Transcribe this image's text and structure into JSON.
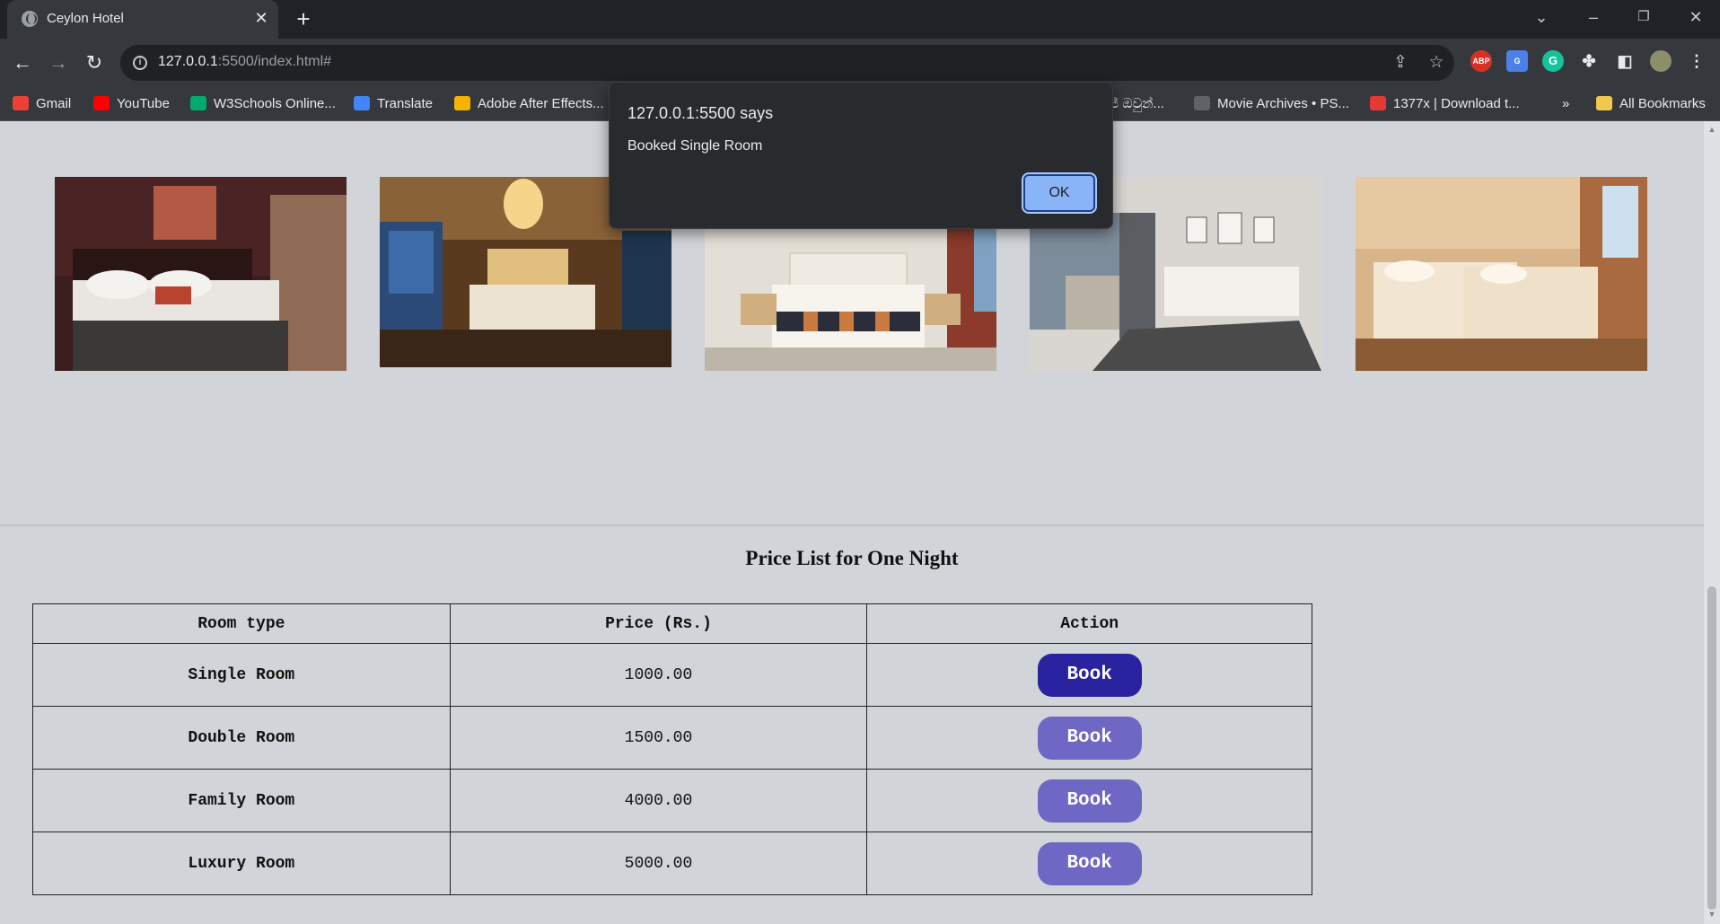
{
  "browser": {
    "tab_title": "Ceylon Hotel",
    "url_host": "127.0.0.1",
    "url_rest": ":5500/index.html#",
    "bookmarks": [
      {
        "label": "Gmail",
        "icon": "gmail-icon",
        "color": "#ea4335"
      },
      {
        "label": "YouTube",
        "icon": "youtube-icon",
        "color": "#ff0000"
      },
      {
        "label": "W3Schools Online...",
        "icon": "w3schools-icon",
        "color": "#04aa6d"
      },
      {
        "label": "Translate",
        "icon": "translate-icon",
        "color": "#4285f4"
      },
      {
        "label": "Adobe After Effects...",
        "icon": "adobe-icon",
        "color": "#f4b400"
      },
      {
        "label": "ජ් ඔවුන්...",
        "icon": "bookmark-icon",
        "color": "#5f6368"
      },
      {
        "label": "Movie Archives • PS...",
        "icon": "movie-icon",
        "color": "#5f6368"
      },
      {
        "label": "1377x | Download t...",
        "icon": "x-icon",
        "color": "#e53935"
      },
      {
        "label": "All Bookmarks",
        "icon": "folder-icon",
        "color": "#f2c94c"
      }
    ],
    "overflow_label": "»"
  },
  "alert": {
    "title": "127.0.0.1:5500 says",
    "message": "Booked Single Room",
    "ok_label": "OK"
  },
  "gallery": {
    "images": [
      "room-photo-1",
      "room-photo-2",
      "room-photo-3",
      "room-photo-4",
      "room-photo-5"
    ]
  },
  "price_list": {
    "heading": "Price List for One Night",
    "columns": [
      "Room type",
      "Price (Rs.)",
      "Action"
    ],
    "rows": [
      {
        "room": "Single Room",
        "price": "1000.00",
        "action": "Book",
        "button_color": "#2a23a0"
      },
      {
        "room": "Double Room",
        "price": "1500.00",
        "action": "Book",
        "button_color": "#6f67c4"
      },
      {
        "room": "Family Room",
        "price": "4000.00",
        "action": "Book",
        "button_color": "#6f67c4"
      },
      {
        "room": "Luxury Room",
        "price": "5000.00",
        "action": "Book",
        "button_color": "#6f67c4"
      }
    ]
  }
}
